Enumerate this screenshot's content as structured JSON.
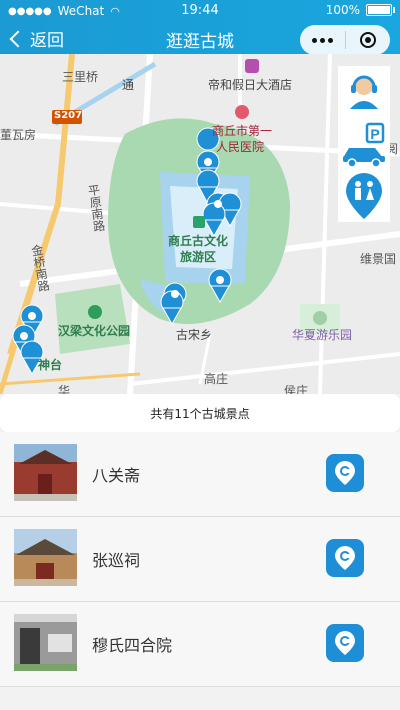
{
  "status": {
    "carrier": "WeChat",
    "time": "19:44",
    "battery": "100%",
    "battery_level": 1.0
  },
  "nav": {
    "back_label": "返回",
    "title": "逛逛古城"
  },
  "map": {
    "labels": {
      "sanli_bridge": "三里桥",
      "tonghe": "通",
      "hotel": "帝和假日大酒店",
      "hospital_line1": "商丘市第一",
      "hospital_line2": "人民医院",
      "road_s207": "S207",
      "dong_wa_fang": "董瓦房",
      "pingyuan_road": "平原南路",
      "jinqiao_road": "金桥南路",
      "scenic_line1": "商丘古文化",
      "scenic_line2": "旅游区",
      "weijing": "维景国",
      "hanliang_park": "汉梁文化公园",
      "gusong": "古宋乡",
      "huaxia_park": "华夏游乐园",
      "gaozhuang": "高庄",
      "houzhuang": "侯庄",
      "shentai": "神台",
      "hua": "华",
      "yue": "阅"
    }
  },
  "summary": {
    "text": "共有11个古城景点"
  },
  "list": {
    "items": [
      {
        "name": "八关斋"
      },
      {
        "name": "张巡祠"
      },
      {
        "name": "穆氏四合院"
      }
    ]
  },
  "colors": {
    "accent": "#1b9ad3",
    "map_green": "#9ad3a4",
    "map_water": "#a7d3ef",
    "pin_blue": "#1f8fd6"
  }
}
